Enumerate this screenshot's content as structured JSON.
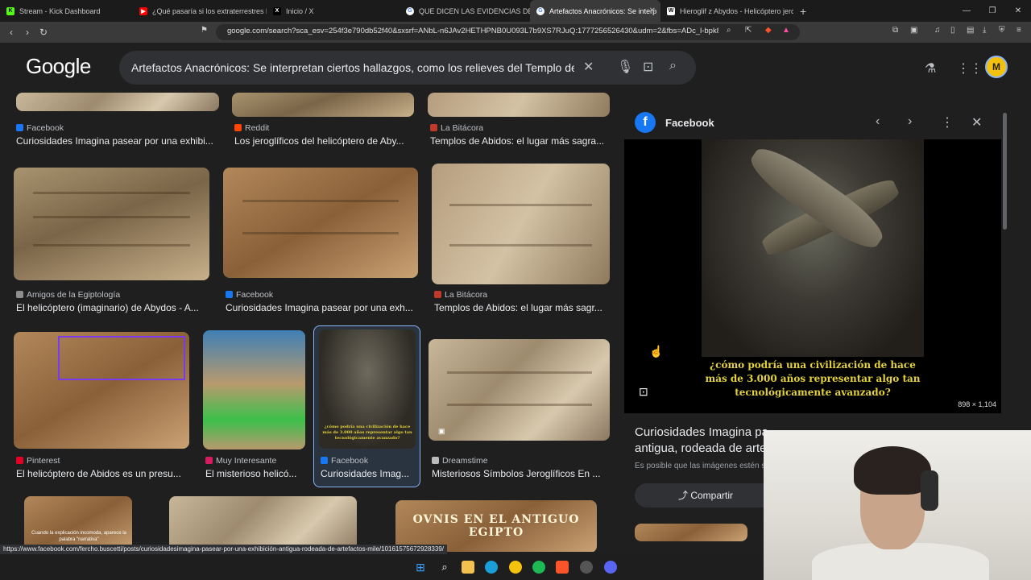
{
  "tabs": [
    {
      "title": "Stream - Kick Dashboard",
      "icon": "kick-icon",
      "color": "#53fc18",
      "glyph": "K"
    },
    {
      "title": "¿Qué pasaría si los extraterrestres lle",
      "icon": "youtube-icon",
      "color": "#ff0000",
      "glyph": "▶"
    },
    {
      "title": "Inicio / X",
      "icon": "x-icon",
      "color": "#000000",
      "glyph": "X"
    },
    {
      "title": "QUE DICEN LAS EVIDENCIAS DE LAS",
      "icon": "google-icon",
      "color": "#ffffff",
      "glyph": "G"
    },
    {
      "title": "Artefactos Anacrónicos: Se interp",
      "icon": "google-icon",
      "color": "#ffffff",
      "glyph": "G"
    },
    {
      "title": "Hieroglif z Abydos - Helicóptero jero",
      "icon": "wikipedia-icon",
      "color": "#ffffff",
      "glyph": "W"
    }
  ],
  "address": {
    "url": "google.com/search?sca_esv=254f3e790db52f40&sxsrf=ANbL-n6JAv2HETHPNB0U093L7b9XS7RJuQ:1777256526430&udm=2&fbs=ADc_l-bpk8..."
  },
  "search": {
    "query": "Artefactos Anacrónicos: Se interpretan ciertos hallazgos, como los relieves del Templo de A"
  },
  "google_logo": "Google",
  "avatar_initial": "M",
  "results": [
    {
      "source": "Facebook",
      "title": "Curiosidades Imagina pasear por una exhibi...",
      "fav_color": "#1877f2"
    },
    {
      "source": "Reddit",
      "title": "Los jeroglíficos del helicóptero de Aby...",
      "fav_color": "#ff4500"
    },
    {
      "source": "La Bitácora",
      "title": "Templos de Abidos: el lugar más sagra...",
      "fav_color": "#c0392b"
    },
    {
      "source": "Amigos de la Egiptología",
      "title": "El helicóptero (imaginario) de Abydos - A...",
      "fav_color": "#8e8e8e"
    },
    {
      "source": "Facebook",
      "title": "Curiosidades Imagina pasear por una exh...",
      "fav_color": "#1877f2"
    },
    {
      "source": "La Bitácora",
      "title": "Templos de Abidos: el lugar más sagr...",
      "fav_color": "#c0392b"
    },
    {
      "source": "Pinterest",
      "title": "El helicóptero de Abidos es un presu...",
      "fav_color": "#e60023"
    },
    {
      "source": "Muy Interesante",
      "title": "El misterioso helicó...",
      "fav_color": "#d81b60"
    },
    {
      "source": "Facebook",
      "title": "Curiosidades Imag...",
      "fav_color": "#1877f2"
    },
    {
      "source": "Dreamstime",
      "title": "Misteriosos Símbolos Jeroglíficos En ...",
      "fav_color": "#bbbbbb"
    }
  ],
  "bottom_row": {
    "explanation_text": "Cuando la explicación incomoda, aparece la palabra \"narrativa\"",
    "banner": "OVNIS EN EL ANTIGUO EGIPTO"
  },
  "thumb_caption": "¿cómo podría una civilización de hace más de 3.000 años representar algo tan tecnológicamente avanzado?",
  "panel": {
    "site": "Facebook",
    "caption": "¿cómo podría una civilización de hace más de 3.000 años representar algo tan tecnológicamente avanzado?",
    "dimensions": "898 × 1,104",
    "title": "Curiosidades Imagina pa... ...hibición antigua, rodeada de arte...",
    "title_line1": "Curiosidades Imagina pa",
    "title_line2": "antigua, rodeada de arte",
    "desc": "Es posible que las imágenes estén s",
    "share": "Compartir"
  },
  "status_url": "https://www.facebook.com/fercho.buscetti/posts/curiosidadesimagina-pasear-por-una-exhibición-antigua-rodeada-de-artefactos-mile/10161575672928339/",
  "taskbar": [
    "windows-icon",
    "search-icon",
    "file-explorer-icon",
    "edge-icon",
    "chrome-icon",
    "spotify-icon",
    "brave-icon",
    "obs-icon",
    "discord-icon"
  ]
}
